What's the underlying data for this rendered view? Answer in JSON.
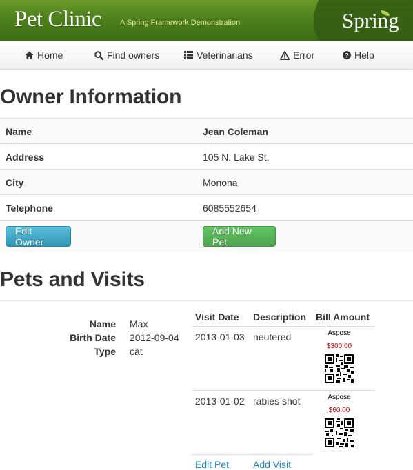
{
  "header": {
    "brand": "Pet Clinic",
    "tagline": "A Spring Framework Demonstration",
    "logo_text": "Spring"
  },
  "nav": {
    "items": [
      {
        "label": "Home",
        "icon": "home-icon"
      },
      {
        "label": "Find owners",
        "icon": "search-icon"
      },
      {
        "label": "Veterinarians",
        "icon": "list-icon"
      },
      {
        "label": "Error",
        "icon": "warning-icon"
      },
      {
        "label": "Help",
        "icon": "help-icon"
      }
    ]
  },
  "owner": {
    "heading": "Owner Information",
    "rows": [
      {
        "label": "Name",
        "value": "Jean Coleman"
      },
      {
        "label": "Address",
        "value": "105 N. Lake St."
      },
      {
        "label": "City",
        "value": "Monona"
      },
      {
        "label": "Telephone",
        "value": "6085552654"
      }
    ],
    "edit_button": "Edit Owner",
    "add_pet_button": "Add New Pet"
  },
  "pets": {
    "heading": "Pets and Visits",
    "pet": {
      "name_label": "Name",
      "name": "Max",
      "birth_label": "Birth Date",
      "birth_date": "2012-09-04",
      "type_label": "Type",
      "type": "cat"
    },
    "visit_headers": {
      "date": "Visit Date",
      "description": "Description",
      "bill": "Bill Amount"
    },
    "visits": [
      {
        "date": "2013-01-03",
        "description": "neutered",
        "bill_vendor": "Aspose",
        "bill_amount": "$300.00"
      },
      {
        "date": "2013-01-02",
        "description": "rabies shot",
        "bill_vendor": "Aspose",
        "bill_amount": "$60.00"
      }
    ],
    "edit_pet_link": "Edit Pet",
    "add_visit_link": "Add Visit"
  },
  "colors": {
    "banner_green": "#4c7f1c",
    "info_button": "#2f96b4",
    "success_button": "#51a351",
    "link": "#1e88c8",
    "bill_amount": "#d00000"
  }
}
